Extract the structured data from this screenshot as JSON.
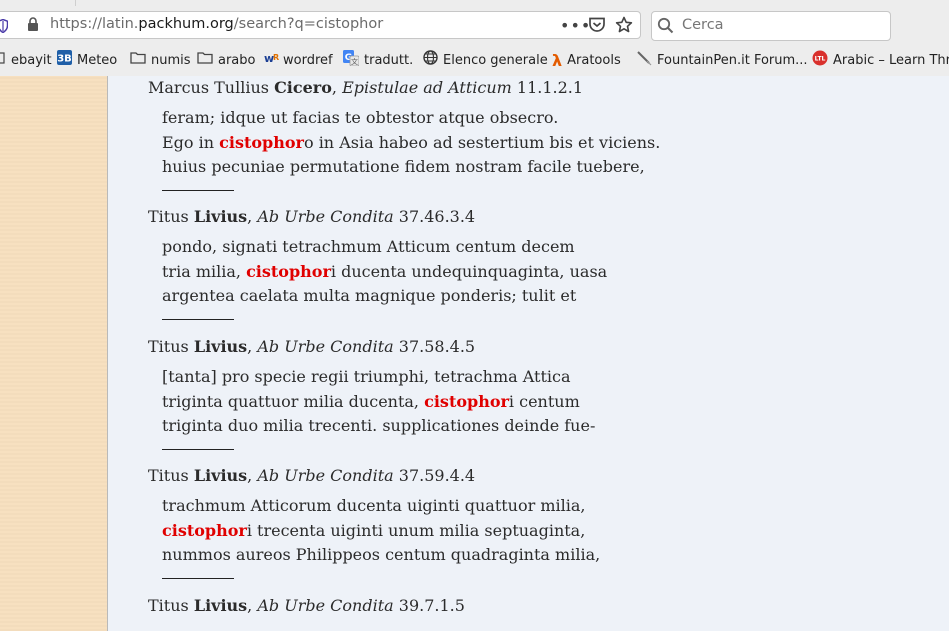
{
  "browser": {
    "url_prefix": "https://latin.",
    "url_domain": "packhum.org",
    "url_suffix": "/search?q=cistophor",
    "search_placeholder": "Cerca"
  },
  "bookmarks": [
    {
      "label": "ebayit",
      "icon": "folder-icon"
    },
    {
      "label": "Meteo",
      "icon": "meteo-icon"
    },
    {
      "label": "numis",
      "icon": "folder-icon"
    },
    {
      "label": "arabo",
      "icon": "folder-icon"
    },
    {
      "label": "wordref",
      "icon": "wordref-icon"
    },
    {
      "label": "tradutt.",
      "icon": "translate-icon"
    },
    {
      "label": "Elenco generale",
      "icon": "globe-icon"
    },
    {
      "label": "Aratools",
      "icon": "lambda-icon"
    },
    {
      "label": "FountainPen.it Forum...",
      "icon": "pen-icon"
    },
    {
      "label": "Arabic – Learn Thro",
      "icon": "ltl-icon"
    }
  ],
  "results": [
    {
      "author_first": "Marcus Tullius ",
      "author_bold": "Cicero",
      "sep": ", ",
      "work": "Epistulae ad Atticum",
      "ref": " 11.1.2.1",
      "lines": [
        {
          "pre": "feram; idque ut facias te obtestor atque obsecro.",
          "hl": "",
          "post": ""
        },
        {
          "pre": "Ego in ",
          "hl": "cistophor",
          "post": "o in Asia habeo ad sestertium bis et viciens."
        },
        {
          "pre": "huius pecuniae permutatione fidem nostram facile tuebere,",
          "hl": "",
          "post": ""
        }
      ]
    },
    {
      "author_first": "Titus ",
      "author_bold": "Livius",
      "sep": ", ",
      "work": "Ab Urbe Condita",
      "ref": " 37.46.3.4",
      "lines": [
        {
          "pre": "pondo, signati tetrachmum Atticum centum decem",
          "hl": "",
          "post": ""
        },
        {
          "pre": "tria milia, ",
          "hl": "cistophor",
          "post": "i ducenta undequinquaginta, uasa"
        },
        {
          "pre": "argentea caelata multa magnique ponderis; tulit et",
          "hl": "",
          "post": ""
        }
      ]
    },
    {
      "author_first": "Titus ",
      "author_bold": "Livius",
      "sep": ", ",
      "work": "Ab Urbe Condita",
      "ref": " 37.58.4.5",
      "lines": [
        {
          "pre": "[tanta] pro specie regii triumphi, tetrachma Attica",
          "hl": "",
          "post": ""
        },
        {
          "pre": "triginta quattuor milia ducenta, ",
          "hl": "cistophor",
          "post": "i centum"
        },
        {
          "pre": "triginta duo milia trecenti. supplicationes deinde fue-",
          "hl": "",
          "post": ""
        }
      ]
    },
    {
      "author_first": "Titus ",
      "author_bold": "Livius",
      "sep": ", ",
      "work": "Ab Urbe Condita",
      "ref": " 37.59.4.4",
      "lines": [
        {
          "pre": "trachmum Atticorum ducenta uiginti quattuor milia,",
          "hl": "",
          "post": ""
        },
        {
          "pre": "",
          "hl": "cistophor",
          "post": "i trecenta uiginti unum milia septuaginta,"
        },
        {
          "pre": "nummos aureos Philippeos centum quadraginta milia,",
          "hl": "",
          "post": ""
        }
      ]
    },
    {
      "author_first": "Titus ",
      "author_bold": "Livius",
      "sep": ", ",
      "work": "Ab Urbe Condita",
      "ref": " 39.7.1.5",
      "lines": []
    }
  ]
}
